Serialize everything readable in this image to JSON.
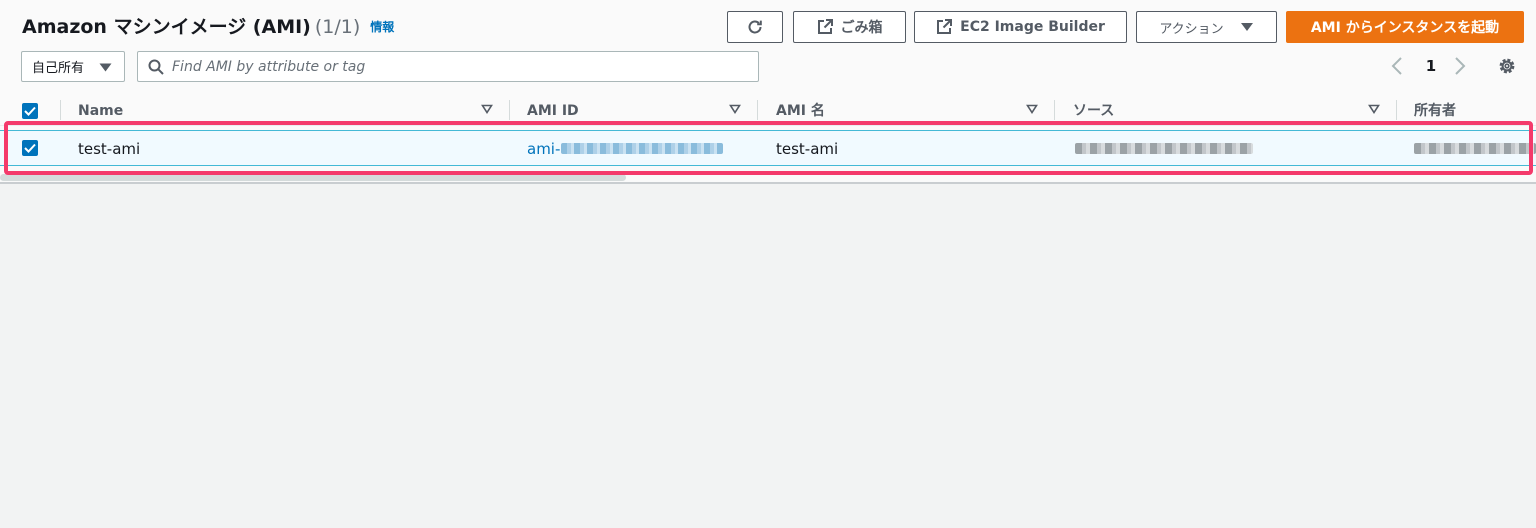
{
  "header": {
    "title": "Amazon マシンイメージ (AMI)",
    "count": "(1/1)",
    "info_link": "情報"
  },
  "toolbar": {
    "refresh_icon": "refresh-icon",
    "recycle_bin_label": "ごみ箱",
    "image_builder_label": "EC2 Image Builder",
    "actions_label": "アクション",
    "launch_label": "AMI からインスタンスを起動"
  },
  "filter": {
    "owner_selected": "自己所有",
    "search_placeholder": "Find AMI by attribute or tag"
  },
  "pagination": {
    "current_page": "1"
  },
  "table": {
    "columns": [
      {
        "label": "Name"
      },
      {
        "label": "AMI ID"
      },
      {
        "label": "AMI 名"
      },
      {
        "label": "ソース"
      },
      {
        "label": "所有者"
      }
    ],
    "rows": [
      {
        "selected": true,
        "name": "test-ami",
        "ami_id_prefix": "ami-",
        "ami_name": "test-ami"
      }
    ]
  },
  "colors": {
    "primary": "#ec7211",
    "link": "#0073bb",
    "highlight": "#f43a6b"
  }
}
